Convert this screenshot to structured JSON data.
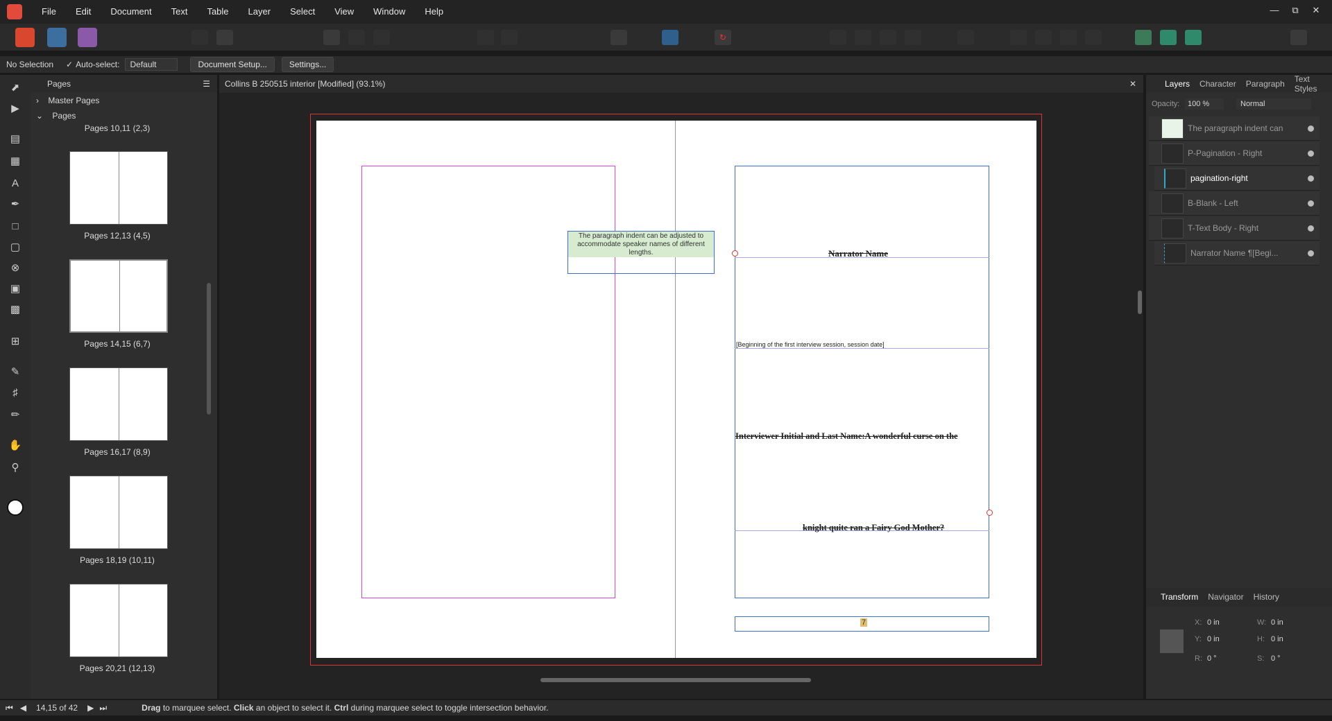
{
  "menu": [
    "File",
    "Edit",
    "Document",
    "Text",
    "Table",
    "Layer",
    "Select",
    "View",
    "Window",
    "Help"
  ],
  "context": {
    "selection": "No Selection",
    "autoselect_label": "Auto-select:",
    "autoselect_value": "Default",
    "doc_setup": "Document Setup...",
    "settings": "Settings..."
  },
  "pages_panel": {
    "title": "Pages",
    "master_pages": "Master Pages",
    "pages": "Pages",
    "top_cut_label": "Pages 10,11 (2,3)",
    "spreads": [
      {
        "label": "Pages 12,13 (4,5)"
      },
      {
        "label": "Pages 14,15 (6,7)"
      },
      {
        "label": "Pages 16,17 (8,9)"
      },
      {
        "label": "Pages 18,19 (10,11)"
      },
      {
        "label": "Pages 20,21 (12,13)"
      }
    ]
  },
  "document": {
    "tab_title": "Collins B 250515 interior [Modified] (93.1%)",
    "callout": "The paragraph indent can be adjusted to accommodate speaker names of different lengths.",
    "narrator": "Narrator Name",
    "beginning": "[Beginning of the first interview session, session date]",
    "interviewer": "Interviewer Initial and Last Name:A  wonderful  curse  on  the",
    "knight": "knight quite ran a Fairy God Mother?",
    "page_num": "7"
  },
  "right_panel": {
    "tabs": [
      "Layers",
      "Character",
      "Paragraph",
      "Text Styles"
    ],
    "opacity_label": "Opacity:",
    "opacity_value": "100 %",
    "blend": "Normal",
    "layers": [
      {
        "name": "The paragraph indent can"
      },
      {
        "name": "P-Pagination - Right"
      },
      {
        "name": "pagination-right"
      },
      {
        "name": "B-Blank - Left"
      },
      {
        "name": "T-Text Body - Right"
      },
      {
        "name": "Narrator Name ¶[Begi..."
      }
    ],
    "bottom_tabs": [
      "Transform",
      "Navigator",
      "History"
    ],
    "transform": {
      "x_label": "X:",
      "x": "0 in",
      "y_label": "Y:",
      "y": "0 in",
      "w_label": "W:",
      "w": "0 in",
      "h_label": "H:",
      "h": "0 in",
      "r_label": "R:",
      "r": "0 °",
      "s_label": "S:",
      "s": "0 °"
    }
  },
  "status": {
    "page_indicator": "14,15 of 42",
    "hint_drag": "Drag",
    "hint_1": " to marquee select. ",
    "hint_click": "Click",
    "hint_2": " an object to select it. ",
    "hint_ctrl": "Ctrl",
    "hint_3": " during marquee select to toggle intersection behavior."
  }
}
